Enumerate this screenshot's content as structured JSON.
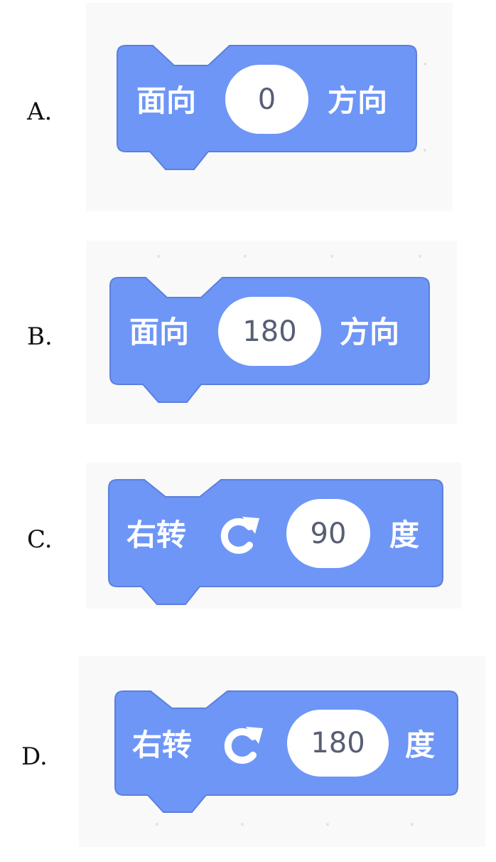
{
  "options": [
    {
      "letter": "A.",
      "label_left": "面向",
      "value": "0",
      "label_right": "方向",
      "icon": ""
    },
    {
      "letter": "B.",
      "label_left": "面向",
      "value": "180",
      "label_right": "方向",
      "icon": ""
    },
    {
      "letter": "C.",
      "label_left": "右转",
      "value": "90",
      "label_right": "度",
      "icon": "turn-right-icon"
    },
    {
      "letter": "D.",
      "label_left": "右转",
      "value": "180",
      "label_right": "度",
      "icon": "turn-right-icon"
    }
  ],
  "colors": {
    "block_fill": "#6e96f7",
    "block_stroke": "#5b80dc",
    "panel_bg": "#f9f9f9",
    "input_text": "#575e75"
  }
}
